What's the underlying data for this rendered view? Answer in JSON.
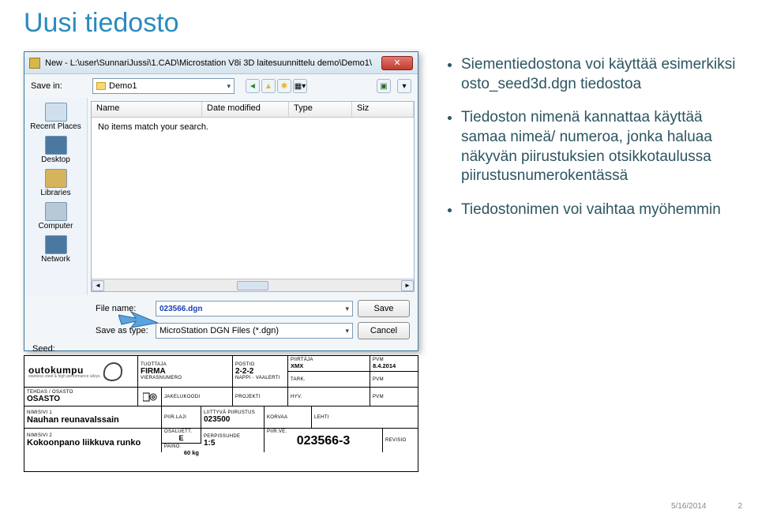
{
  "page_title": "Uusi tiedosto",
  "dialog": {
    "title": "New - L:\\user\\SunnariJussi\\1.CAD\\Microstation V8i 3D laitesuunnittelu demo\\Demo1\\",
    "save_in_label": "Save in:",
    "save_in_value": "Demo1",
    "toolbar_icons": [
      "back-icon",
      "up-icon",
      "newfolder-icon",
      "views-icon",
      "extra1-icon",
      "extra2-icon"
    ],
    "columns": [
      "Name",
      "Date modified",
      "Type",
      "Siz"
    ],
    "empty_msg": "No items match your search.",
    "places": [
      "Recent Places",
      "Desktop",
      "Libraries",
      "Computer",
      "Network"
    ],
    "file_name_label": "File name:",
    "file_name_value": "023566.dgn",
    "save_as_type_label": "Save as type:",
    "save_as_type_value": "MicroStation DGN Files (*.dgn)",
    "save_btn": "Save",
    "cancel_btn": "Cancel",
    "seed_label": "Seed:"
  },
  "titleblock": {
    "brand": "outokumpu",
    "tagline": "stainless steel & high performance alloys",
    "tuotanto_label": "TUOTTAJA",
    "firma": "FIRMA",
    "vierasnro_label": "VIERASNUMERO",
    "postio_label": "POSTIO",
    "postio": "2-2-2",
    "piirtaja_label": "PIIRTÄJA",
    "piirtaja": "XMX",
    "pvm_label": "PVM",
    "pvm": "8.4.2014",
    "nappi_label": "NAPPI - VAALERTI",
    "tark_label": "TARK.",
    "tark_pvm_label": "PVM",
    "tehdas_label": "TEHDAS / OSASTO",
    "osasto": "OSASTO",
    "jakelukoodi_label": "JAKELUKOODI",
    "projekti_label": "PROJEKTI",
    "hyv_label": "HYV.",
    "hyv_pvm_label": "PVM",
    "nimsivi1_label": "NIMISIVI 1",
    "nimsivi1": "Nauhan reunavalssain",
    "pirlaji_label": "PIIR.LAJI",
    "liittyva_label": "LIITTYVÄ PIIRUSTUS",
    "liittyva": "023500",
    "korvaa_label": "KORVAA",
    "lehti_label": "LEHTI",
    "nimsivi2_label": "NIMISIVI 2",
    "nimsivi2": "Kokoonpano liikkuva runko",
    "osaluett_label": "OSALUETT.",
    "osaluett": "E",
    "perpissuhde_label": "PERPISSUHDE",
    "perpissuhde": "1:5",
    "piirus_label": "PIIR.VE.",
    "piirus": "023566-3",
    "revisio_label": "REVISIO",
    "paino_label": "PAINO",
    "paino": "60 kg"
  },
  "bullets": {
    "b1": "Siementiedostona voi käyttää esimerkiksi osto_seed3d.dgn tiedostoa",
    "b2": "Tiedoston nimenä kannattaa käyttää samaa nimeä/ numeroa, jonka haluaa näkyvän piirustuksien otsikkotaulussa piirustusnumerokentässä",
    "b3": "Tiedostonimen voi vaihtaa myöhemmin"
  },
  "footer": {
    "date": "5/16/2014",
    "page": "2"
  }
}
